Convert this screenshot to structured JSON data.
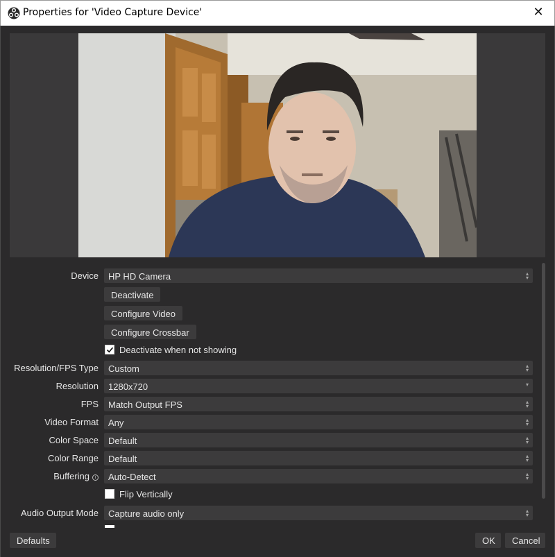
{
  "window": {
    "title": "Properties for 'Video Capture Device'",
    "close_glyph": "✕"
  },
  "form": {
    "device": {
      "label": "Device",
      "value": "HP HD Camera"
    },
    "deactivate_button": "Deactivate",
    "configure_video_button": "Configure Video",
    "configure_crossbar_button": "Configure Crossbar",
    "deactivate_when_not_showing": {
      "label": "Deactivate when not showing",
      "checked": true
    },
    "resolution_fps_type": {
      "label": "Resolution/FPS Type",
      "value": "Custom"
    },
    "resolution": {
      "label": "Resolution",
      "value": "1280x720"
    },
    "fps": {
      "label": "FPS",
      "value": "Match Output FPS"
    },
    "video_format": {
      "label": "Video Format",
      "value": "Any"
    },
    "color_space": {
      "label": "Color Space",
      "value": "Default"
    },
    "color_range": {
      "label": "Color Range",
      "value": "Default"
    },
    "buffering": {
      "label": "Buffering",
      "value": "Auto-Detect"
    },
    "flip_vertically": {
      "label": "Flip Vertically",
      "checked": false
    },
    "audio_output_mode": {
      "label": "Audio Output Mode",
      "value": "Capture audio only"
    }
  },
  "footer": {
    "defaults_button": "Defaults",
    "ok_button": "OK",
    "cancel_button": "Cancel"
  },
  "icons": {
    "app": "obs-logo-icon",
    "close": "close-icon",
    "combo": "spin-arrows-icon",
    "dropdown": "chevron-down-icon",
    "checkmark": "checkmark-icon",
    "info": "info-icon"
  },
  "colors": {
    "background": "#2b2a2b",
    "control": "#3c3b3c",
    "text": "#e6e6e6",
    "titlebar": "#ffffff"
  }
}
